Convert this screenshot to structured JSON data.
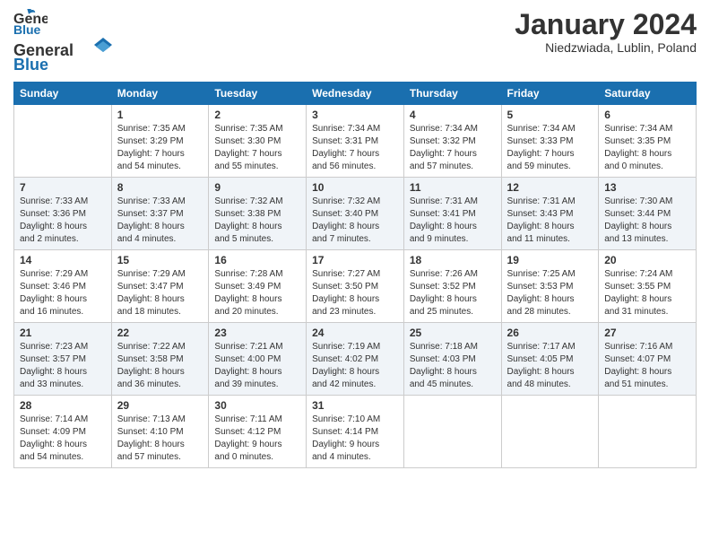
{
  "header": {
    "logo_general": "General",
    "logo_blue": "Blue",
    "month": "January 2024",
    "location": "Niedzwiada, Lublin, Poland"
  },
  "days_of_week": [
    "Sunday",
    "Monday",
    "Tuesday",
    "Wednesday",
    "Thursday",
    "Friday",
    "Saturday"
  ],
  "weeks": [
    [
      {
        "day": "",
        "info": ""
      },
      {
        "day": "1",
        "info": "Sunrise: 7:35 AM\nSunset: 3:29 PM\nDaylight: 7 hours\nand 54 minutes."
      },
      {
        "day": "2",
        "info": "Sunrise: 7:35 AM\nSunset: 3:30 PM\nDaylight: 7 hours\nand 55 minutes."
      },
      {
        "day": "3",
        "info": "Sunrise: 7:34 AM\nSunset: 3:31 PM\nDaylight: 7 hours\nand 56 minutes."
      },
      {
        "day": "4",
        "info": "Sunrise: 7:34 AM\nSunset: 3:32 PM\nDaylight: 7 hours\nand 57 minutes."
      },
      {
        "day": "5",
        "info": "Sunrise: 7:34 AM\nSunset: 3:33 PM\nDaylight: 7 hours\nand 59 minutes."
      },
      {
        "day": "6",
        "info": "Sunrise: 7:34 AM\nSunset: 3:35 PM\nDaylight: 8 hours\nand 0 minutes."
      }
    ],
    [
      {
        "day": "7",
        "info": "Sunrise: 7:33 AM\nSunset: 3:36 PM\nDaylight: 8 hours\nand 2 minutes."
      },
      {
        "day": "8",
        "info": "Sunrise: 7:33 AM\nSunset: 3:37 PM\nDaylight: 8 hours\nand 4 minutes."
      },
      {
        "day": "9",
        "info": "Sunrise: 7:32 AM\nSunset: 3:38 PM\nDaylight: 8 hours\nand 5 minutes."
      },
      {
        "day": "10",
        "info": "Sunrise: 7:32 AM\nSunset: 3:40 PM\nDaylight: 8 hours\nand 7 minutes."
      },
      {
        "day": "11",
        "info": "Sunrise: 7:31 AM\nSunset: 3:41 PM\nDaylight: 8 hours\nand 9 minutes."
      },
      {
        "day": "12",
        "info": "Sunrise: 7:31 AM\nSunset: 3:43 PM\nDaylight: 8 hours\nand 11 minutes."
      },
      {
        "day": "13",
        "info": "Sunrise: 7:30 AM\nSunset: 3:44 PM\nDaylight: 8 hours\nand 13 minutes."
      }
    ],
    [
      {
        "day": "14",
        "info": "Sunrise: 7:29 AM\nSunset: 3:46 PM\nDaylight: 8 hours\nand 16 minutes."
      },
      {
        "day": "15",
        "info": "Sunrise: 7:29 AM\nSunset: 3:47 PM\nDaylight: 8 hours\nand 18 minutes."
      },
      {
        "day": "16",
        "info": "Sunrise: 7:28 AM\nSunset: 3:49 PM\nDaylight: 8 hours\nand 20 minutes."
      },
      {
        "day": "17",
        "info": "Sunrise: 7:27 AM\nSunset: 3:50 PM\nDaylight: 8 hours\nand 23 minutes."
      },
      {
        "day": "18",
        "info": "Sunrise: 7:26 AM\nSunset: 3:52 PM\nDaylight: 8 hours\nand 25 minutes."
      },
      {
        "day": "19",
        "info": "Sunrise: 7:25 AM\nSunset: 3:53 PM\nDaylight: 8 hours\nand 28 minutes."
      },
      {
        "day": "20",
        "info": "Sunrise: 7:24 AM\nSunset: 3:55 PM\nDaylight: 8 hours\nand 31 minutes."
      }
    ],
    [
      {
        "day": "21",
        "info": "Sunrise: 7:23 AM\nSunset: 3:57 PM\nDaylight: 8 hours\nand 33 minutes."
      },
      {
        "day": "22",
        "info": "Sunrise: 7:22 AM\nSunset: 3:58 PM\nDaylight: 8 hours\nand 36 minutes."
      },
      {
        "day": "23",
        "info": "Sunrise: 7:21 AM\nSunset: 4:00 PM\nDaylight: 8 hours\nand 39 minutes."
      },
      {
        "day": "24",
        "info": "Sunrise: 7:19 AM\nSunset: 4:02 PM\nDaylight: 8 hours\nand 42 minutes."
      },
      {
        "day": "25",
        "info": "Sunrise: 7:18 AM\nSunset: 4:03 PM\nDaylight: 8 hours\nand 45 minutes."
      },
      {
        "day": "26",
        "info": "Sunrise: 7:17 AM\nSunset: 4:05 PM\nDaylight: 8 hours\nand 48 minutes."
      },
      {
        "day": "27",
        "info": "Sunrise: 7:16 AM\nSunset: 4:07 PM\nDaylight: 8 hours\nand 51 minutes."
      }
    ],
    [
      {
        "day": "28",
        "info": "Sunrise: 7:14 AM\nSunset: 4:09 PM\nDaylight: 8 hours\nand 54 minutes."
      },
      {
        "day": "29",
        "info": "Sunrise: 7:13 AM\nSunset: 4:10 PM\nDaylight: 8 hours\nand 57 minutes."
      },
      {
        "day": "30",
        "info": "Sunrise: 7:11 AM\nSunset: 4:12 PM\nDaylight: 9 hours\nand 0 minutes."
      },
      {
        "day": "31",
        "info": "Sunrise: 7:10 AM\nSunset: 4:14 PM\nDaylight: 9 hours\nand 4 minutes."
      },
      {
        "day": "",
        "info": ""
      },
      {
        "day": "",
        "info": ""
      },
      {
        "day": "",
        "info": ""
      }
    ]
  ]
}
